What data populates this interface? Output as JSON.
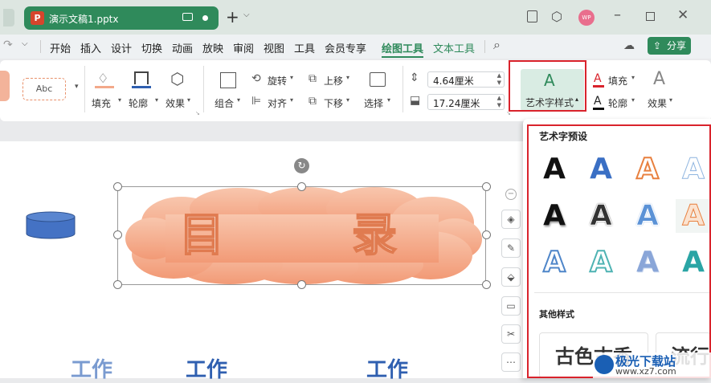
{
  "window": {
    "tab_title": "演示文稿1.pptx",
    "app_icon_letter": "P",
    "avatar_text": "WP",
    "accent": "#2f8a5b"
  },
  "menu": {
    "items": [
      "开始",
      "插入",
      "设计",
      "切换",
      "动画",
      "放映",
      "审阅",
      "视图",
      "工具",
      "会员专享",
      "绘图工具",
      "文本工具"
    ],
    "active": "绘图工具",
    "share": "分享"
  },
  "ribbon": {
    "style_preview": "Abc",
    "fill": "填充",
    "outline": "轮廓",
    "effect": "效果",
    "group": "组合",
    "rotate": "旋转",
    "align": "对齐",
    "up": "上移",
    "down": "下移",
    "select": "选择",
    "width": "4.64厘米",
    "height": "17.24厘米",
    "wordart_style": "艺术字样式",
    "text_fill": "填充",
    "text_outline": "轮廓",
    "text_effect": "效果"
  },
  "slide": {
    "cloud_text_left": "目",
    "cloud_text_right": "录",
    "items_partial": [
      "工作",
      "工作",
      "工作"
    ]
  },
  "panel": {
    "title": "艺术字预设",
    "other": "其他样式",
    "preset_letter": "A",
    "style_samples": [
      "古色古香",
      "流行"
    ]
  },
  "watermark": {
    "name": "极光下载站",
    "url": "www.xz7.com"
  }
}
